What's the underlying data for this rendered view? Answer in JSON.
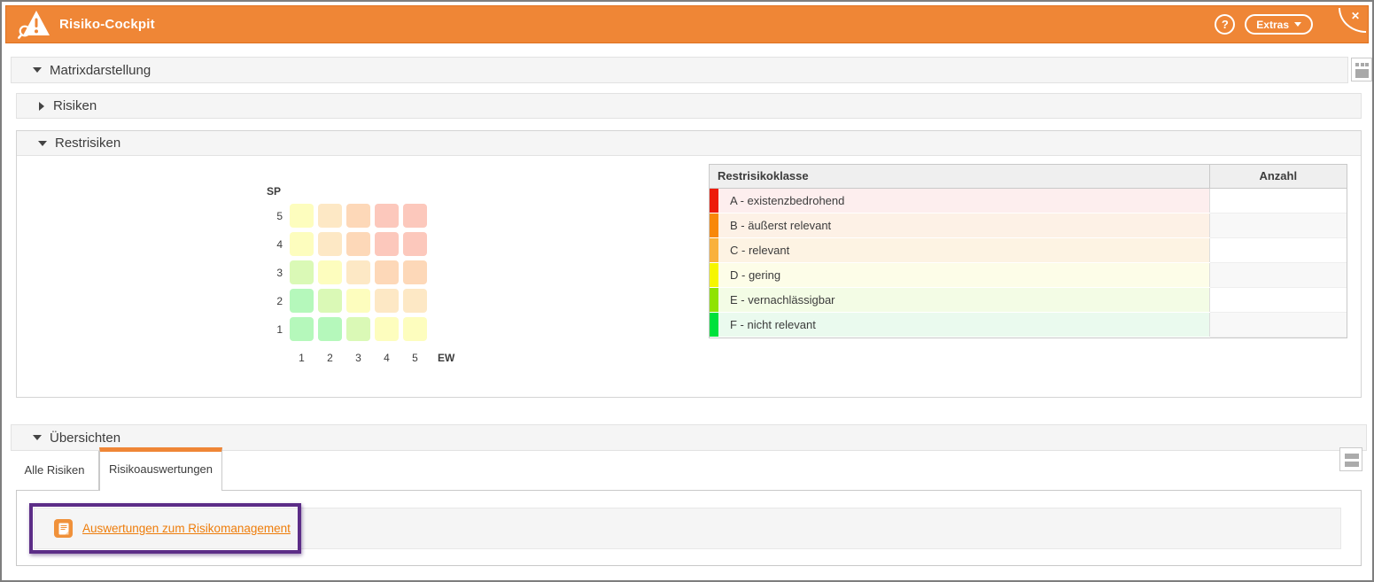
{
  "header": {
    "title": "Risiko-Cockpit",
    "help_label": "?",
    "extras_label": "Extras",
    "close_label": "✕"
  },
  "sections": {
    "matrixdarstellung": "Matrixdarstellung",
    "risiken": "Risiken",
    "restrisiken": "Restrisiken",
    "uebersichten": "Übersichten"
  },
  "matrix": {
    "y_label": "SP",
    "x_label": "EW",
    "rows": [
      "5",
      "4",
      "3",
      "2",
      "1"
    ],
    "cols": [
      "1",
      "2",
      "3",
      "4",
      "5"
    ],
    "cells": [
      [
        "D",
        "C",
        "B",
        "A",
        "A"
      ],
      [
        "D",
        "C",
        "B",
        "A",
        "A"
      ],
      [
        "E",
        "D",
        "C",
        "B",
        "B"
      ],
      [
        "F",
        "E",
        "D",
        "C",
        "C"
      ],
      [
        "F",
        "F",
        "E",
        "D",
        "D"
      ]
    ],
    "class_cell_colors": {
      "A": "#fcc8bc",
      "B": "#fdd8b8",
      "C": "#fde8c5",
      "D": "#fdfdbe",
      "E": "#daf9b6",
      "F": "#b5f8bb"
    }
  },
  "restrisiko_table": {
    "headers": {
      "klasse": "Restrisikoklasse",
      "anzahl": "Anzahl"
    },
    "rows": [
      {
        "klasse": "A - existenzbedrohend",
        "anzahl": "",
        "bar": "#ed1c0a",
        "bg": "#fdeeee"
      },
      {
        "klasse": "B - äußerst relevant",
        "anzahl": "",
        "bar": "#f8880a",
        "bg": "#fdf1e6"
      },
      {
        "klasse": "C - relevant",
        "anzahl": "",
        "bar": "#f9b13c",
        "bg": "#fdf3e3"
      },
      {
        "klasse": "D - gering",
        "anzahl": "",
        "bar": "#f6f600",
        "bg": "#fdfde8"
      },
      {
        "klasse": "E - vernachlässigbar",
        "anzahl": "",
        "bar": "#8fe303",
        "bg": "#f3fce5"
      },
      {
        "klasse": "F - nicht relevant",
        "anzahl": "",
        "bar": "#00e13c",
        "bg": "#eafaee"
      }
    ]
  },
  "tabs": [
    {
      "label": "Alle Risiken",
      "active": false
    },
    {
      "label": "Risikoauswertungen",
      "active": true
    }
  ],
  "overview_link": {
    "label": "Auswertungen zum Risikomanagement"
  },
  "colors": {
    "accent_orange": "#ef8636",
    "link_orange": "#ee7d0b",
    "highlight_purple": "#5c2d87"
  }
}
